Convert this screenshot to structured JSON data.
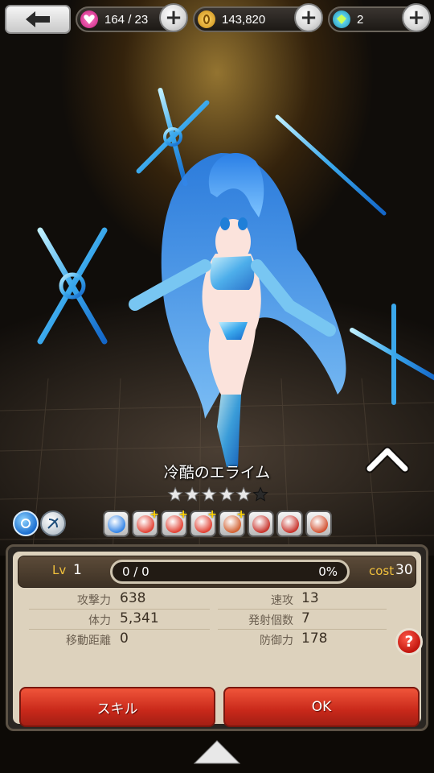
{
  "resources": {
    "stamina": "164 / 23",
    "gold": "143,820",
    "gems": "2"
  },
  "character": {
    "name": "冷酷のエライム",
    "stars_total": 6,
    "stars_filled": 5
  },
  "skills": [
    {
      "icon": "snowflake-skill-icon"
    },
    {
      "icon": "fist-attack-up-icon"
    },
    {
      "icon": "fist-defense-up-icon"
    },
    {
      "icon": "heart-up-icon"
    },
    {
      "icon": "thermometer-icon"
    },
    {
      "icon": "shield-icon"
    },
    {
      "icon": "fist-down-icon"
    },
    {
      "icon": "clock-icon"
    }
  ],
  "status": {
    "lv_label": "Lv",
    "lv_value": "1",
    "exp_text": "0 / 0",
    "exp_percent": "0%",
    "cost_label": "cost",
    "cost_value": "30"
  },
  "stats": {
    "attack_label": "攻撃力",
    "attack_value": "638",
    "hp_label": "体力",
    "hp_value": "5,341",
    "move_label": "移動距離",
    "move_value": "0",
    "speed_label": "速攻",
    "speed_value": "13",
    "shots_label": "発射個数",
    "shots_value": "7",
    "defense_label": "防御力",
    "defense_value": "178"
  },
  "buttons": {
    "skill": "スキル",
    "ok": "OK",
    "help": "?"
  },
  "colors": {
    "accent_red": "#c8281a",
    "gold_label": "#f0c03c",
    "panel_bg": "#ddd2bd"
  }
}
